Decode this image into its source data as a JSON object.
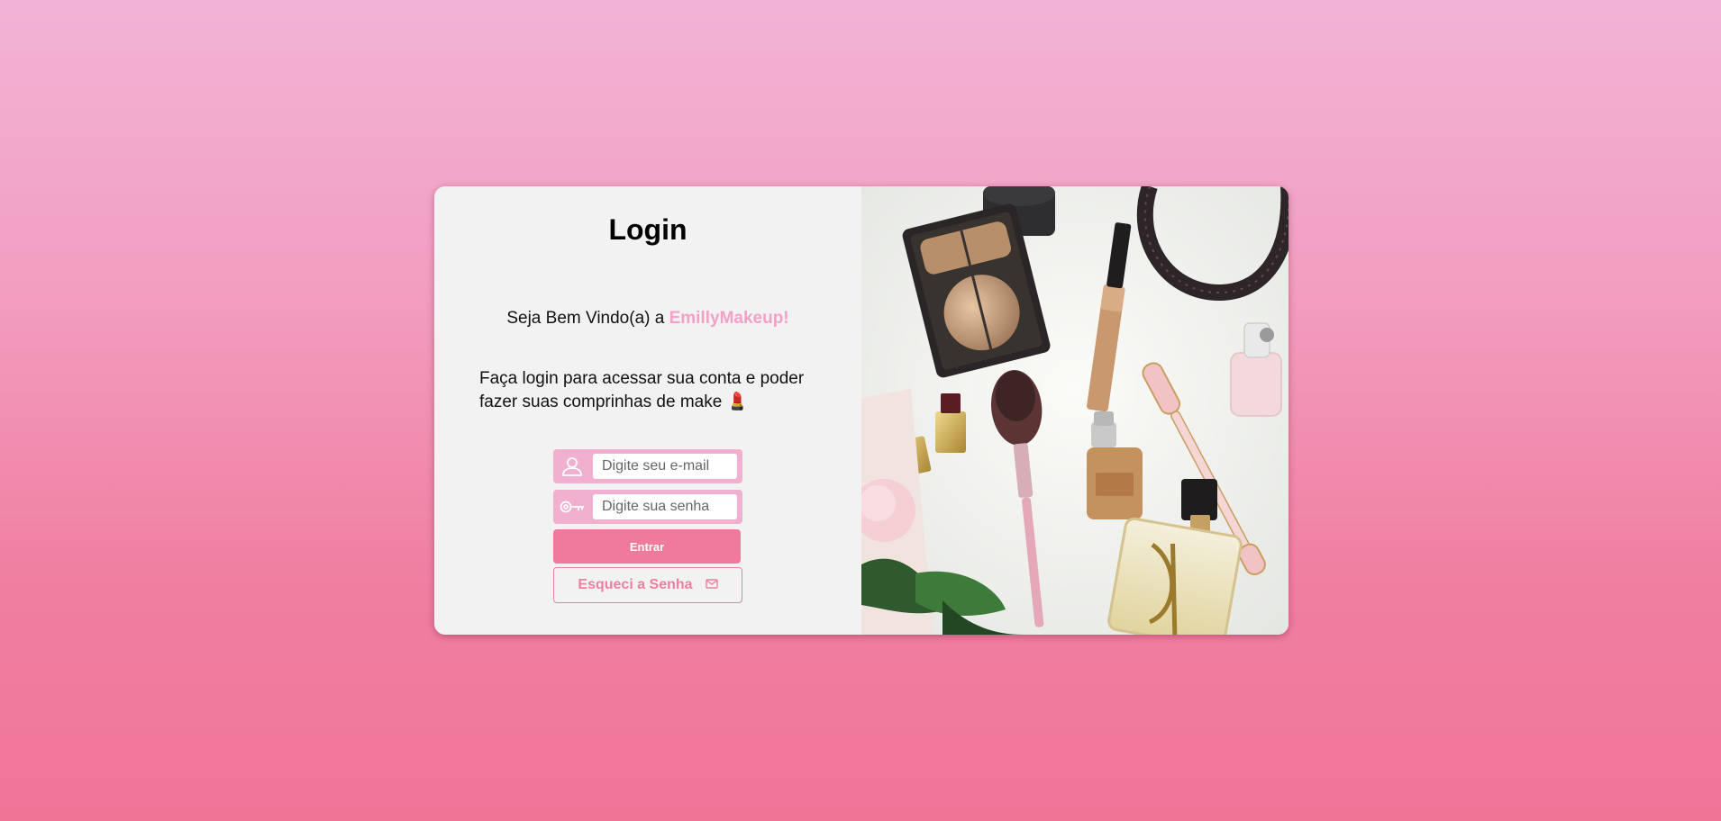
{
  "login": {
    "title": "Login",
    "welcome_prefix": "Seja Bem Vindo(a) a ",
    "brand": "EmillyMakeup!",
    "description": "Faça login para acessar sua conta e poder fazer suas comprinhas de make 💄",
    "email_placeholder": "Digite seu e-mail",
    "password_placeholder": "Digite sua senha",
    "submit_label": "Entrar",
    "forgot_label": "Esqueci a Senha"
  },
  "icons": {
    "email_field": "user-icon",
    "password_field": "key-icon",
    "forgot_button": "mail-icon"
  },
  "colors": {
    "brand": "#f2a1c9",
    "field_bg": "#f2b0d1",
    "button": "#f07a9c"
  }
}
